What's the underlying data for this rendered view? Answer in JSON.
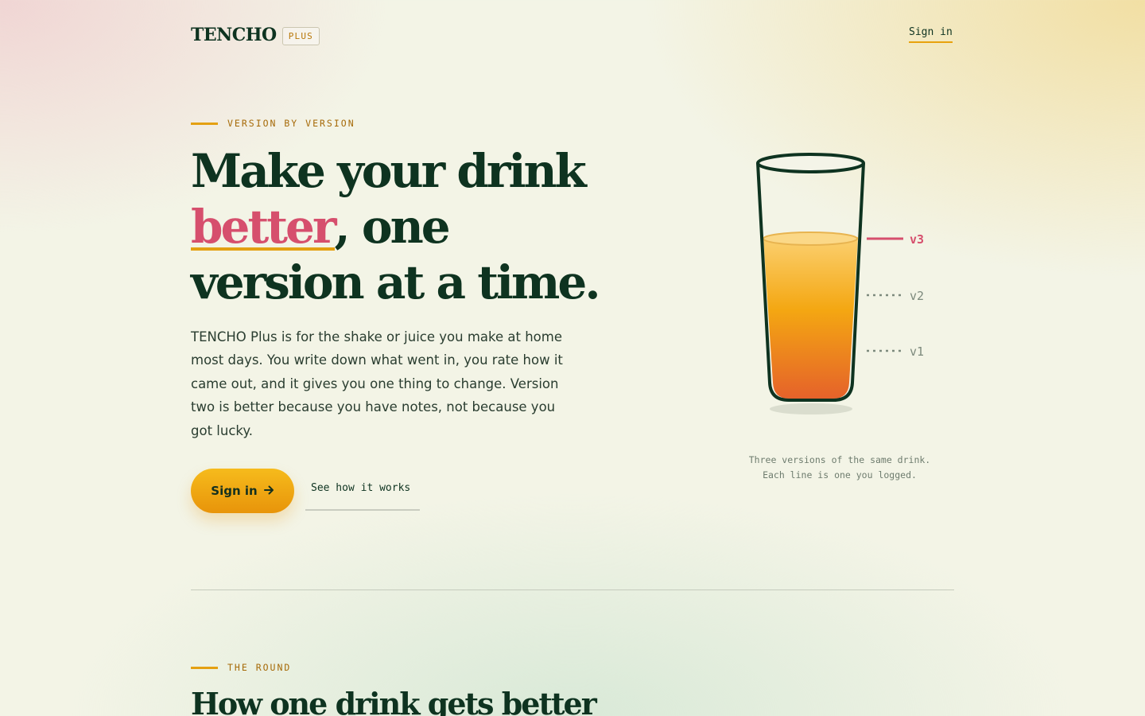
{
  "brand": {
    "name": "TENCHO",
    "badge": "PLUS"
  },
  "nav": {
    "signin_label": "Sign in"
  },
  "hero": {
    "eyebrow": "VERSION BY VERSION",
    "headline_line1": "Make your drink",
    "headline_highlight": "better",
    "headline_rest": ", one",
    "headline_line3": "version at a time.",
    "lede": "TENCHO Plus is for the shake or juice you make at home most days. You write down what went in, you rate how it came out, and it gives you one thing to change. Version two is better because you have notes, not because you got lucky.",
    "primary_cta": "Sign in",
    "primary_cta_icon": "arrow-right-icon",
    "secondary_cta": "See how it works"
  },
  "illustration": {
    "versions": [
      {
        "label": "v3",
        "color": "#d64f6d",
        "style": "solid"
      },
      {
        "label": "v2",
        "color": "#7d8a7d",
        "style": "dotted"
      },
      {
        "label": "v1",
        "color": "#7d8a7d",
        "style": "dotted"
      }
    ],
    "caption": "Three versions of the same drink. Each line is one you logged."
  },
  "section2": {
    "eyebrow": "THE ROUND",
    "title": "How one drink gets better"
  },
  "colors": {
    "ink": "#0e3320",
    "accent_pink": "#d64f6d",
    "accent_amber": "#e4a012"
  }
}
